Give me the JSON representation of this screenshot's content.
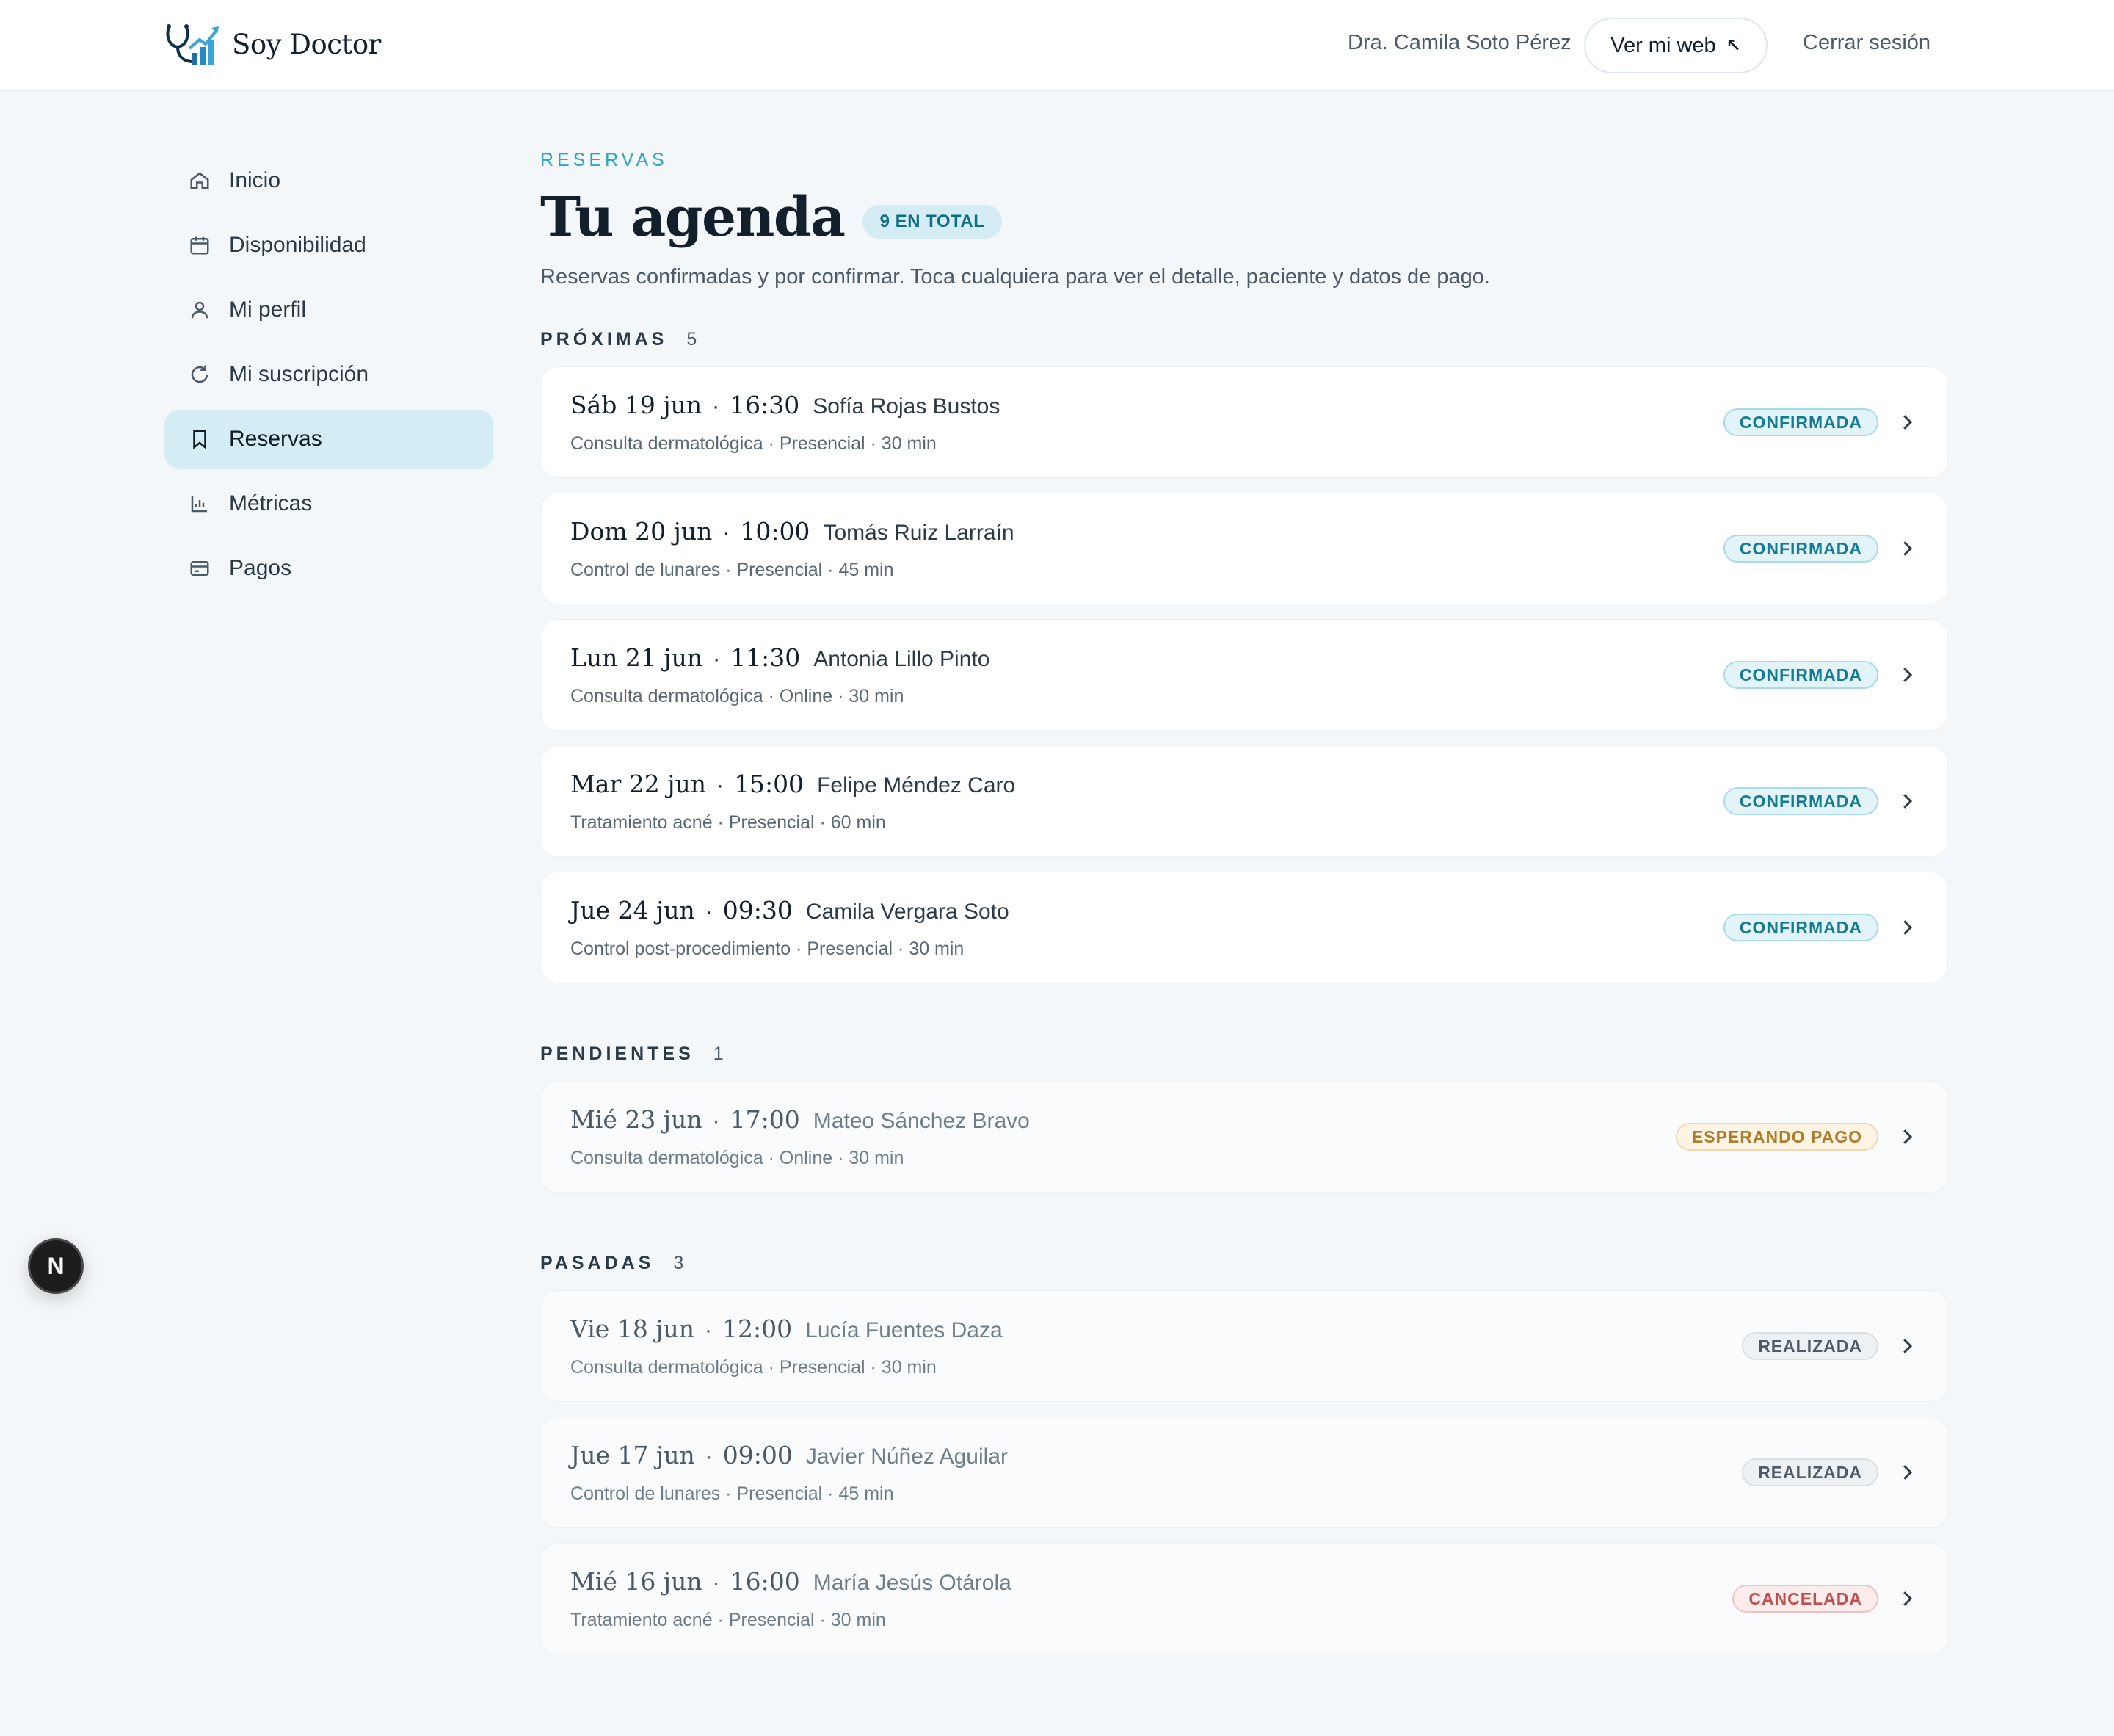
{
  "header": {
    "brand": "Soy Doctor",
    "user_name": "Dra. Camila Soto Pérez",
    "web_button": "Ver mi web",
    "web_arrow": "↖",
    "logout": "Cerrar sesión"
  },
  "sidebar": {
    "items": [
      {
        "label": "Inicio",
        "icon": "home-icon"
      },
      {
        "label": "Disponibilidad",
        "icon": "calendar-icon"
      },
      {
        "label": "Mi perfil",
        "icon": "user-icon"
      },
      {
        "label": "Mi suscripción",
        "icon": "refresh-icon"
      },
      {
        "label": "Reservas",
        "icon": "bookmark-icon",
        "active": true
      },
      {
        "label": "Métricas",
        "icon": "bar-chart-icon"
      },
      {
        "label": "Pagos",
        "icon": "credit-card-icon"
      }
    ]
  },
  "page": {
    "eyebrow": "RESERVAS",
    "title": "Tu agenda",
    "total_badge": "9 EN TOTAL",
    "subtitle": "Reservas confirmadas y por confirmar. Toca cualquiera para ver el detalle, paciente y datos de pago."
  },
  "sections": [
    {
      "title": "PRÓXIMAS",
      "count": "5",
      "items": [
        {
          "date": "Sáb 19 jun",
          "time": "16:30",
          "patient": "Sofía Rojas Bustos",
          "detail": "Consulta dermatológica · Presencial · 30 min",
          "status": "CONFIRMADA"
        },
        {
          "date": "Dom 20 jun",
          "time": "10:00",
          "patient": "Tomás Ruiz Larraín",
          "detail": "Control de lunares · Presencial · 45 min",
          "status": "CONFIRMADA"
        },
        {
          "date": "Lun 21 jun",
          "time": "11:30",
          "patient": "Antonia Lillo Pinto",
          "detail": "Consulta dermatológica · Online · 30 min",
          "status": "CONFIRMADA"
        },
        {
          "date": "Mar 22 jun",
          "time": "15:00",
          "patient": "Felipe Méndez Caro",
          "detail": "Tratamiento acné · Presencial · 60 min",
          "status": "CONFIRMADA"
        },
        {
          "date": "Jue 24 jun",
          "time": "09:30",
          "patient": "Camila Vergara Soto",
          "detail": "Control post-procedimiento · Presencial · 30 min",
          "status": "CONFIRMADA"
        }
      ]
    },
    {
      "title": "PENDIENTES",
      "count": "1",
      "items": [
        {
          "date": "Mié 23 jun",
          "time": "17:00",
          "patient": "Mateo Sánchez Bravo",
          "detail": "Consulta dermatológica · Online · 30 min",
          "status": "ESPERANDO PAGO"
        }
      ]
    },
    {
      "title": "PASADAS",
      "count": "3",
      "items": [
        {
          "date": "Vie 18 jun",
          "time": "12:00",
          "patient": "Lucía Fuentes Daza",
          "detail": "Consulta dermatológica · Presencial · 30 min",
          "status": "REALIZADA"
        },
        {
          "date": "Jue 17 jun",
          "time": "09:00",
          "patient": "Javier Núñez Aguilar",
          "detail": "Control de lunares · Presencial · 45 min",
          "status": "REALIZADA"
        },
        {
          "date": "Mié 16 jun",
          "time": "16:00",
          "patient": "María Jesús Otárola",
          "detail": "Tratamiento acné · Presencial · 30 min",
          "status": "CANCELADA"
        }
      ]
    }
  ],
  "fab": {
    "label": "N"
  },
  "colors": {
    "accent": "#2aa6c0",
    "active_nav": "#d4ecf3",
    "confirmed": "#137a93",
    "pending": "#b07a2b",
    "cancelled": "#c24d4d"
  }
}
